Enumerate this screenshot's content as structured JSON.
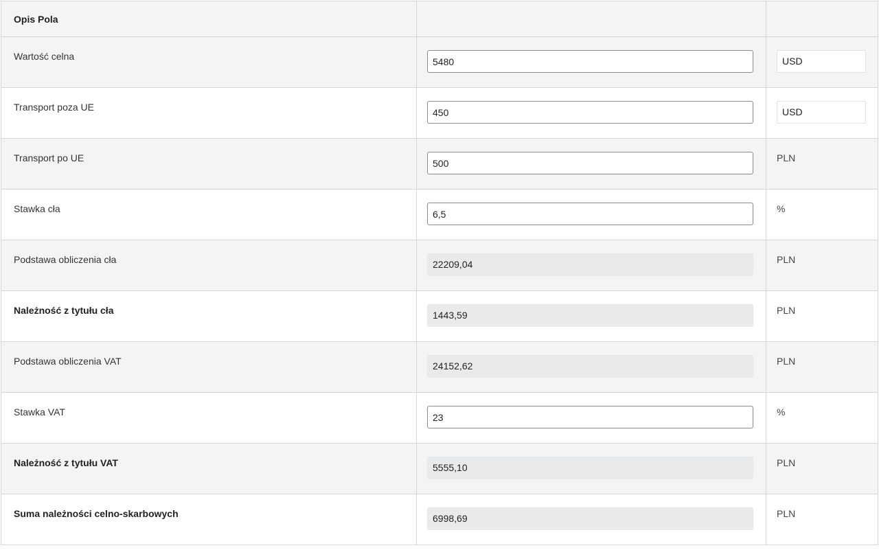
{
  "table": {
    "header": {
      "label": "Opis Pola",
      "value": "",
      "unit": ""
    },
    "rows": [
      {
        "label": "Wartość celna",
        "value": "5480",
        "editable": true,
        "bold": false,
        "currency": "USD"
      },
      {
        "label": "Transport poza UE",
        "value": "450",
        "editable": true,
        "bold": false,
        "currency": "USD"
      },
      {
        "label": "Transport po UE",
        "value": "500",
        "editable": true,
        "bold": false,
        "unit": "PLN"
      },
      {
        "label": "Stawka cła",
        "value": "6,5",
        "editable": true,
        "bold": false,
        "unit": "%"
      },
      {
        "label": "Podstawa obliczenia cła",
        "value": "22209,04",
        "editable": false,
        "bold": false,
        "unit": "PLN"
      },
      {
        "label": "Należność z tytułu cła",
        "value": "1443,59",
        "editable": false,
        "bold": true,
        "unit": "PLN"
      },
      {
        "label": "Podstawa obliczenia VAT",
        "value": "24152,62",
        "editable": false,
        "bold": false,
        "unit": "PLN"
      },
      {
        "label": "Stawka VAT",
        "value": "23",
        "editable": true,
        "bold": false,
        "unit": "%"
      },
      {
        "label": "Należność z tytułu VAT",
        "value": "5555,10",
        "editable": false,
        "bold": true,
        "unit": "PLN"
      },
      {
        "label": "Suma należności celno-skarbowych",
        "value": "6998,69",
        "editable": false,
        "bold": true,
        "unit": "PLN"
      }
    ]
  },
  "colors": {
    "shade_row": "#f4f4f4",
    "border": "#d6d6d6",
    "readonly_field": "#e9eaec",
    "input_border": "#8a8a8a"
  }
}
